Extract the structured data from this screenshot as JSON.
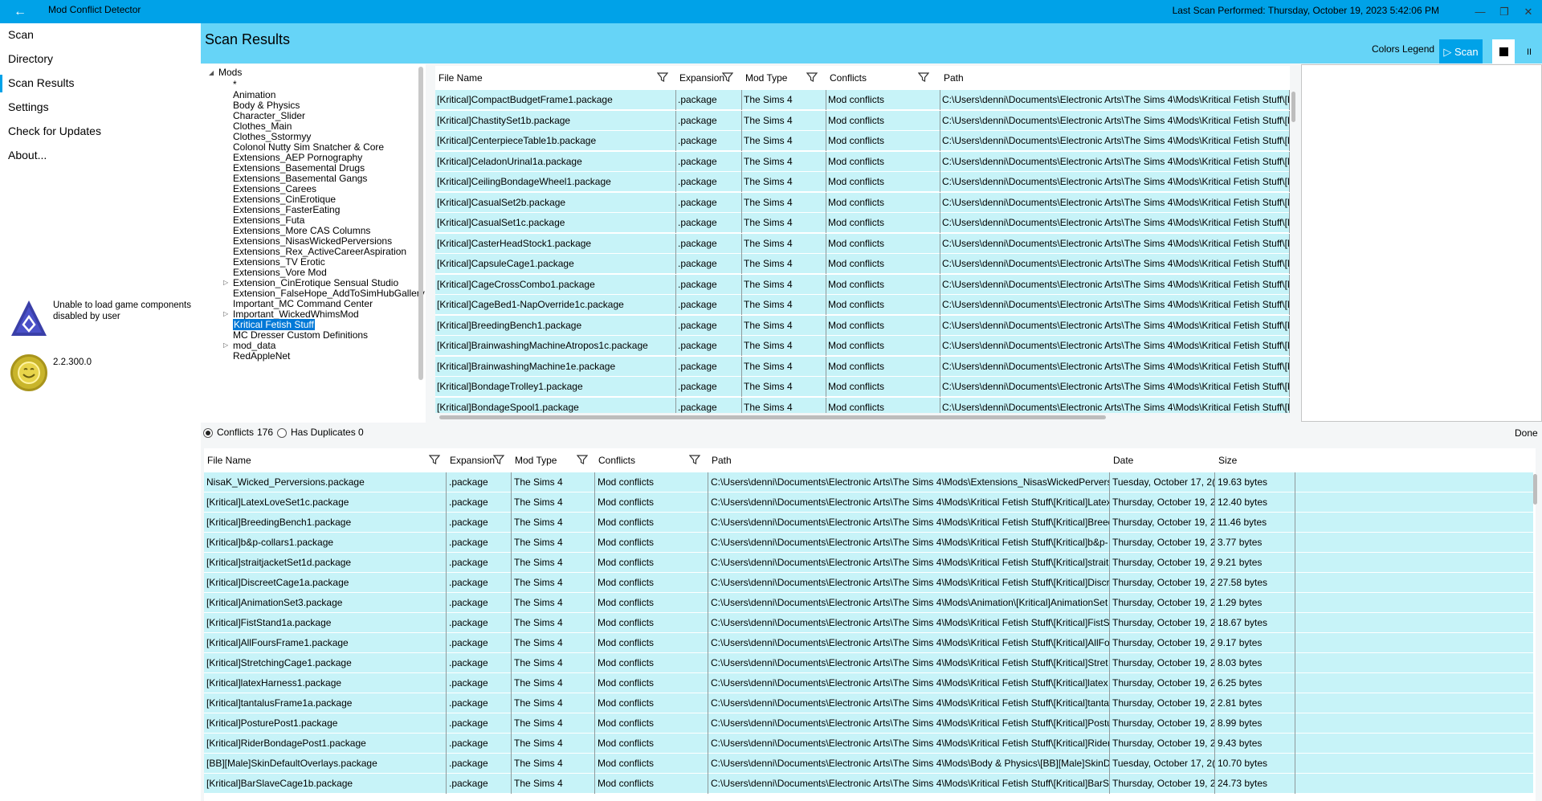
{
  "window": {
    "title": "Mod Conflict Detector",
    "last_scan": "Last Scan Performed: Thursday, October 19, 2023 5:42:06 PM",
    "accent": "#00a2e8",
    "header_color": "#66d4f7",
    "row_color": "#c7f3f8"
  },
  "sidebar": {
    "items": [
      "Scan",
      "Directory",
      "Scan Results",
      "Settings",
      "Check for Updates",
      "About..."
    ],
    "active": "Scan Results",
    "warning": "Unable to load game components disabled by user",
    "version": "2.2.300.0"
  },
  "header": {
    "title": "Scan Results",
    "colors_legend": "Colors Legend",
    "scan_label": "▷ Scan",
    "pause_label": "II"
  },
  "tree": {
    "root": "Mods",
    "items": [
      "*",
      "Animation",
      "Body & Physics",
      "Character_Slider",
      "Clothes_Main",
      "Clothes_Sstormyy",
      "Colonol Nutty Sim Snatcher & Core",
      "Extensions_AEP Pornography",
      "Extensions_Basemental Drugs",
      "Extensions_Basemental Gangs",
      "Extensions_Carees",
      "Extensions_CinErotique",
      "Extensions_FasterEating",
      "Extensions_Futa",
      "Extensions_More CAS Columns",
      "Extensions_NisasWickedPerversions",
      "Extensions_Rex_ActiveCareerAspiration",
      "Extensions_TV Erotic",
      "Extensions_Vore Mod",
      "Extension_CinErotique Sensual Studio",
      "Extension_FalseHope_AddToSimHubGallery",
      "Important_MC Command Center",
      "Important_WickedWhimsMod",
      "Kritical Fetish Stuff",
      "MC Dresser Custom Definitions",
      "mod_data",
      "RedAppleNet"
    ],
    "expandable": [
      "Extension_CinErotique Sensual Studio",
      "Important_WickedWhimsMod",
      "mod_data"
    ],
    "selected": "Kritical Fetish Stuff"
  },
  "grid1": {
    "columns": [
      "File Name",
      "Expansion",
      "Mod Type",
      "Conflicts",
      "Path"
    ],
    "rows": [
      [
        "[Kritical]CompactBudgetFrame1.package",
        ".package",
        "The Sims 4",
        "Mod conflicts",
        "C:\\Users\\denni\\Documents\\Electronic Arts\\The Sims 4\\Mods\\Kritical Fetish Stuff\\[K"
      ],
      [
        "[Kritical]ChastitySet1b.package",
        ".package",
        "The Sims 4",
        "Mod conflicts",
        "C:\\Users\\denni\\Documents\\Electronic Arts\\The Sims 4\\Mods\\Kritical Fetish Stuff\\[K"
      ],
      [
        "[Kritical]CenterpieceTable1b.package",
        ".package",
        "The Sims 4",
        "Mod conflicts",
        "C:\\Users\\denni\\Documents\\Electronic Arts\\The Sims 4\\Mods\\Kritical Fetish Stuff\\[K"
      ],
      [
        "[Kritical]CeladonUrinal1a.package",
        ".package",
        "The Sims 4",
        "Mod conflicts",
        "C:\\Users\\denni\\Documents\\Electronic Arts\\The Sims 4\\Mods\\Kritical Fetish Stuff\\[K"
      ],
      [
        "[Kritical]CeilingBondageWheel1.package",
        ".package",
        "The Sims 4",
        "Mod conflicts",
        "C:\\Users\\denni\\Documents\\Electronic Arts\\The Sims 4\\Mods\\Kritical Fetish Stuff\\[K"
      ],
      [
        "[Kritical]CasualSet2b.package",
        ".package",
        "The Sims 4",
        "Mod conflicts",
        "C:\\Users\\denni\\Documents\\Electronic Arts\\The Sims 4\\Mods\\Kritical Fetish Stuff\\[K"
      ],
      [
        "[Kritical]CasualSet1c.package",
        ".package",
        "The Sims 4",
        "Mod conflicts",
        "C:\\Users\\denni\\Documents\\Electronic Arts\\The Sims 4\\Mods\\Kritical Fetish Stuff\\[K"
      ],
      [
        "[Kritical]CasterHeadStock1.package",
        ".package",
        "The Sims 4",
        "Mod conflicts",
        "C:\\Users\\denni\\Documents\\Electronic Arts\\The Sims 4\\Mods\\Kritical Fetish Stuff\\[K"
      ],
      [
        "[Kritical]CapsuleCage1.package",
        ".package",
        "The Sims 4",
        "Mod conflicts",
        "C:\\Users\\denni\\Documents\\Electronic Arts\\The Sims 4\\Mods\\Kritical Fetish Stuff\\[K"
      ],
      [
        "[Kritical]CageCrossCombo1.package",
        ".package",
        "The Sims 4",
        "Mod conflicts",
        "C:\\Users\\denni\\Documents\\Electronic Arts\\The Sims 4\\Mods\\Kritical Fetish Stuff\\[K"
      ],
      [
        "[Kritical]CageBed1-NapOverride1c.package",
        ".package",
        "The Sims 4",
        "Mod conflicts",
        "C:\\Users\\denni\\Documents\\Electronic Arts\\The Sims 4\\Mods\\Kritical Fetish Stuff\\[K"
      ],
      [
        "[Kritical]BreedingBench1.package",
        ".package",
        "The Sims 4",
        "Mod conflicts",
        "C:\\Users\\denni\\Documents\\Electronic Arts\\The Sims 4\\Mods\\Kritical Fetish Stuff\\[K"
      ],
      [
        "[Kritical]BrainwashingMachineAtropos1c.package",
        ".package",
        "The Sims 4",
        "Mod conflicts",
        "C:\\Users\\denni\\Documents\\Electronic Arts\\The Sims 4\\Mods\\Kritical Fetish Stuff\\[K"
      ],
      [
        "[Kritical]BrainwashingMachine1e.package",
        ".package",
        "The Sims 4",
        "Mod conflicts",
        "C:\\Users\\denni\\Documents\\Electronic Arts\\The Sims 4\\Mods\\Kritical Fetish Stuff\\[K"
      ],
      [
        "[Kritical]BondageTrolley1.package",
        ".package",
        "The Sims 4",
        "Mod conflicts",
        "C:\\Users\\denni\\Documents\\Electronic Arts\\The Sims 4\\Mods\\Kritical Fetish Stuff\\[K"
      ],
      [
        "[Kritical]BondageSpool1.package",
        ".package",
        "The Sims 4",
        "Mod conflicts",
        "C:\\Users\\denni\\Documents\\Electronic Arts\\The Sims 4\\Mods\\Kritical Fetish Stuff\\[K"
      ]
    ]
  },
  "filter": {
    "conflicts_label": "Conflicts",
    "conflicts_count": "176",
    "duplicates_label": "Has Duplicates",
    "duplicates_count": "0",
    "selected": "conflicts",
    "status": "Done"
  },
  "grid2": {
    "columns": [
      "File Name",
      "Expansion",
      "Mod Type",
      "Conflicts",
      "Path",
      "Date",
      "Size"
    ],
    "rows": [
      [
        "NisaK_Wicked_Perversions.package",
        ".package",
        "The Sims 4",
        "Mod conflicts",
        "C:\\Users\\denni\\Documents\\Electronic Arts\\The Sims 4\\Mods\\Extensions_NisasWickedPerversio",
        "Tuesday, October 17, 2(",
        "19.63 bytes"
      ],
      [
        "[Kritical]LatexLoveSet1c.package",
        ".package",
        "The Sims 4",
        "Mod conflicts",
        "C:\\Users\\denni\\Documents\\Electronic Arts\\The Sims 4\\Mods\\Kritical Fetish Stuff\\[Kritical]Latex",
        "Thursday, October 19, 2",
        "12.40 bytes"
      ],
      [
        "[Kritical]BreedingBench1.package",
        ".package",
        "The Sims 4",
        "Mod conflicts",
        "C:\\Users\\denni\\Documents\\Electronic Arts\\The Sims 4\\Mods\\Kritical Fetish Stuff\\[Kritical]Breed",
        "Thursday, October 19, 2",
        "11.46 bytes"
      ],
      [
        "[Kritical]b&p-collars1.package",
        ".package",
        "The Sims 4",
        "Mod conflicts",
        "C:\\Users\\denni\\Documents\\Electronic Arts\\The Sims 4\\Mods\\Kritical Fetish Stuff\\[Kritical]b&p-",
        "Thursday, October 19, 2",
        "3.77 bytes"
      ],
      [
        "[Kritical]straitjacketSet1d.package",
        ".package",
        "The Sims 4",
        "Mod conflicts",
        "C:\\Users\\denni\\Documents\\Electronic Arts\\The Sims 4\\Mods\\Kritical Fetish Stuff\\[Kritical]strait",
        "Thursday, October 19, 2",
        "9.21 bytes"
      ],
      [
        "[Kritical]DiscreetCage1a.package",
        ".package",
        "The Sims 4",
        "Mod conflicts",
        "C:\\Users\\denni\\Documents\\Electronic Arts\\The Sims 4\\Mods\\Kritical Fetish Stuff\\[Kritical]Discr",
        "Thursday, October 19, 2",
        "27.58 bytes"
      ],
      [
        "[Kritical]AnimationSet3.package",
        ".package",
        "The Sims 4",
        "Mod conflicts",
        "C:\\Users\\denni\\Documents\\Electronic Arts\\The Sims 4\\Mods\\Animation\\[Kritical]AnimationSet",
        "Thursday, October 19, 2",
        "1.29 bytes"
      ],
      [
        "[Kritical]FistStand1a.package",
        ".package",
        "The Sims 4",
        "Mod conflicts",
        "C:\\Users\\denni\\Documents\\Electronic Arts\\The Sims 4\\Mods\\Kritical Fetish Stuff\\[Kritical]FistSt",
        "Thursday, October 19, 2",
        "18.67 bytes"
      ],
      [
        "[Kritical]AllFoursFrame1.package",
        ".package",
        "The Sims 4",
        "Mod conflicts",
        "C:\\Users\\denni\\Documents\\Electronic Arts\\The Sims 4\\Mods\\Kritical Fetish Stuff\\[Kritical]AllFo",
        "Thursday, October 19, 2",
        "9.17 bytes"
      ],
      [
        "[Kritical]StretchingCage1.package",
        ".package",
        "The Sims 4",
        "Mod conflicts",
        "C:\\Users\\denni\\Documents\\Electronic Arts\\The Sims 4\\Mods\\Kritical Fetish Stuff\\[Kritical]Stret",
        "Thursday, October 19, 2",
        "8.03 bytes"
      ],
      [
        "[Kritical]latexHarness1.package",
        ".package",
        "The Sims 4",
        "Mod conflicts",
        "C:\\Users\\denni\\Documents\\Electronic Arts\\The Sims 4\\Mods\\Kritical Fetish Stuff\\[Kritical]latex",
        "Thursday, October 19, 2",
        "6.25 bytes"
      ],
      [
        "[Kritical]tantalusFrame1a.package",
        ".package",
        "The Sims 4",
        "Mod conflicts",
        "C:\\Users\\denni\\Documents\\Electronic Arts\\The Sims 4\\Mods\\Kritical Fetish Stuff\\[Kritical]tanta",
        "Thursday, October 19, 2",
        "2.81 bytes"
      ],
      [
        "[Kritical]PosturePost1.package",
        ".package",
        "The Sims 4",
        "Mod conflicts",
        "C:\\Users\\denni\\Documents\\Electronic Arts\\The Sims 4\\Mods\\Kritical Fetish Stuff\\[Kritical]Postu",
        "Thursday, October 19, 2",
        "8.99 bytes"
      ],
      [
        "[Kritical]RiderBondagePost1.package",
        ".package",
        "The Sims 4",
        "Mod conflicts",
        "C:\\Users\\denni\\Documents\\Electronic Arts\\The Sims 4\\Mods\\Kritical Fetish Stuff\\[Kritical]Rider",
        "Thursday, October 19, 2",
        "9.43 bytes"
      ],
      [
        "[BB][Male]SkinDefaultOverlays.package",
        ".package",
        "The Sims 4",
        "Mod conflicts",
        "C:\\Users\\denni\\Documents\\Electronic Arts\\The Sims 4\\Mods\\Body & Physics\\[BB][Male]SkinD",
        "Tuesday, October 17, 2(",
        "10.70 bytes"
      ],
      [
        "[Kritical]BarSlaveCage1b.package",
        ".package",
        "The Sims 4",
        "Mod conflicts",
        "C:\\Users\\denni\\Documents\\Electronic Arts\\The Sims 4\\Mods\\Kritical Fetish Stuff\\[Kritical]BarSl",
        "Thursday, October 19, 2",
        "24.73 bytes"
      ]
    ]
  }
}
